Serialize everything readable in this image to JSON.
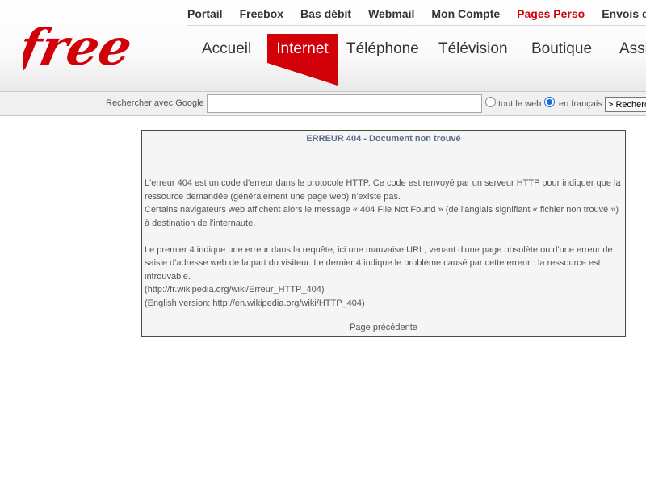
{
  "logo": {
    "text": "free",
    "color": "#d10009"
  },
  "topnav": {
    "items": [
      "Portail",
      "Freebox",
      "Bas débit",
      "Webmail",
      "Mon Compte",
      "Pages Perso",
      "Envois de g"
    ],
    "highlight_index": 5,
    "highlight_color": "#d10009"
  },
  "mainnav": {
    "accueil": "Accueil",
    "internet": "Internet",
    "telephone": "Téléphone",
    "television": "Télévision",
    "boutique": "Boutique",
    "assistance": "Assi",
    "active_color": "#d10009"
  },
  "search": {
    "label": "Rechercher avec Google",
    "value": "",
    "option_web": "tout le web",
    "option_fr": "en français",
    "selected": "en français",
    "button_label": "> Recherc"
  },
  "error": {
    "title": "ERREUR 404 - Document non trouvé",
    "p1": "L'erreur 404 est un code d'erreur dans le protocole HTTP. Ce code est renvoyé par un serveur HTTP pour indiquer que la ressource demandée (généralement une page web) n'existe pas.",
    "p2": "Certains navigateurs web affichent alors le message « 404 File Not Found » (de l'anglais signifiant « fichier non trouvé ») à destination de l'internaute.",
    "p3": "Le premier 4 indique une erreur dans la requête, ici une mauvaise URL, venant d'une page obsolète ou d'une erreur de saisie d'adresse web de la part du visiteur. Le dernier 4 indique le problème causé par cette erreur : la ressource est introuvable.",
    "link_fr": "(http://fr.wikipedia.org/wiki/Erreur_HTTP_404)",
    "link_en": "(English version: http://en.wikipedia.org/wiki/HTTP_404)",
    "back": "Page précédente"
  }
}
